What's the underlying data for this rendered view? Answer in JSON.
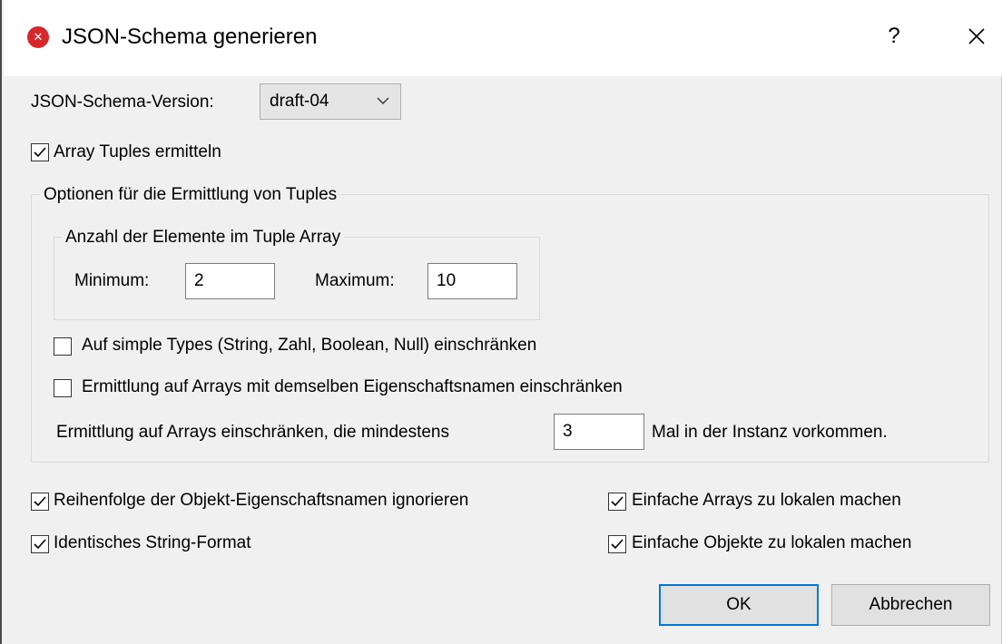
{
  "dialog": {
    "title": "JSON-Schema generieren",
    "help_label": "?"
  },
  "schema_version": {
    "label": "JSON-Schema-Version:",
    "selected": "draft-04"
  },
  "detect_tuples": {
    "label": "Array Tuples ermitteln",
    "checked": true
  },
  "tuple_options": {
    "legend": "Optionen für die Ermittlung von Tuples",
    "element_count": {
      "legend": "Anzahl der Elemente im Tuple Array",
      "min_label": "Minimum:",
      "min_value": "2",
      "max_label": "Maximum:",
      "max_value": "10"
    },
    "simple_types": {
      "label": "Auf simple Types (String, Zahl, Boolean, Null) einschränken",
      "checked": false
    },
    "same_property_names": {
      "label": "Ermittlung auf Arrays mit demselben Eigenschaftsnamen einschränken",
      "checked": false
    },
    "min_occurrence": {
      "label_before": "Ermittlung auf Arrays einschränken, die mindestens",
      "value": "3",
      "label_after": "Mal in der Instanz vorkommen."
    }
  },
  "options": {
    "ignore_order": {
      "label": "Reihenfolge der Objekt-Eigenschaftsnamen ignorieren",
      "checked": true
    },
    "identical_string_format": {
      "label": "Identisches String-Format",
      "checked": true
    },
    "simple_arrays_local": {
      "label": "Einfache Arrays zu lokalen machen",
      "checked": true
    },
    "simple_objects_local": {
      "label": "Einfache Objekte zu lokalen machen",
      "checked": true
    }
  },
  "buttons": {
    "ok": "OK",
    "cancel": "Abbrechen"
  },
  "icons": {
    "app": "altova-app-icon",
    "help": "help-icon",
    "close": "close-icon",
    "dropdown": "chevron-down-icon",
    "check": "checkmark-icon"
  },
  "colors": {
    "dialog_bg": "#f0f0f0",
    "app_icon": "#d8262d",
    "default_button_border": "#0078d7"
  }
}
